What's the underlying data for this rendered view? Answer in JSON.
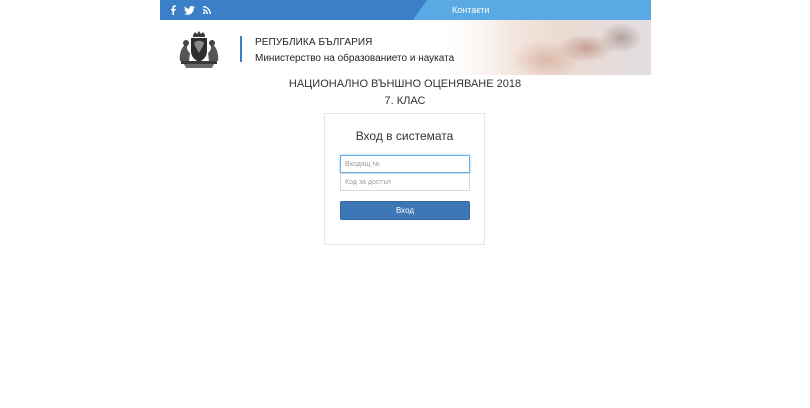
{
  "topbar": {
    "social_icons": [
      "facebook-icon",
      "twitter-icon",
      "rss-icon"
    ],
    "contact_label": "Контакти",
    "colors": {
      "dark": "#3b7fc8",
      "light": "#5aa9e4"
    }
  },
  "header": {
    "logo_icon": "coat-of-arms-icon",
    "title": "РЕПУБЛИКА БЪЛГАРИЯ",
    "subtitle": "Министерство на образованието и науката",
    "accent_color": "#3b7fc8"
  },
  "exam": {
    "title": "НАЦИОНАЛНО ВЪНШНО ОЦЕНЯВАНЕ 2018",
    "grade": "7. КЛАС"
  },
  "login": {
    "heading": "Вход в системата",
    "username_placeholder": "Входящ №",
    "username_value": "",
    "code_placeholder": "Код за достъп",
    "code_value": "",
    "submit_label": "Вход",
    "button_color": "#3c78b5"
  }
}
